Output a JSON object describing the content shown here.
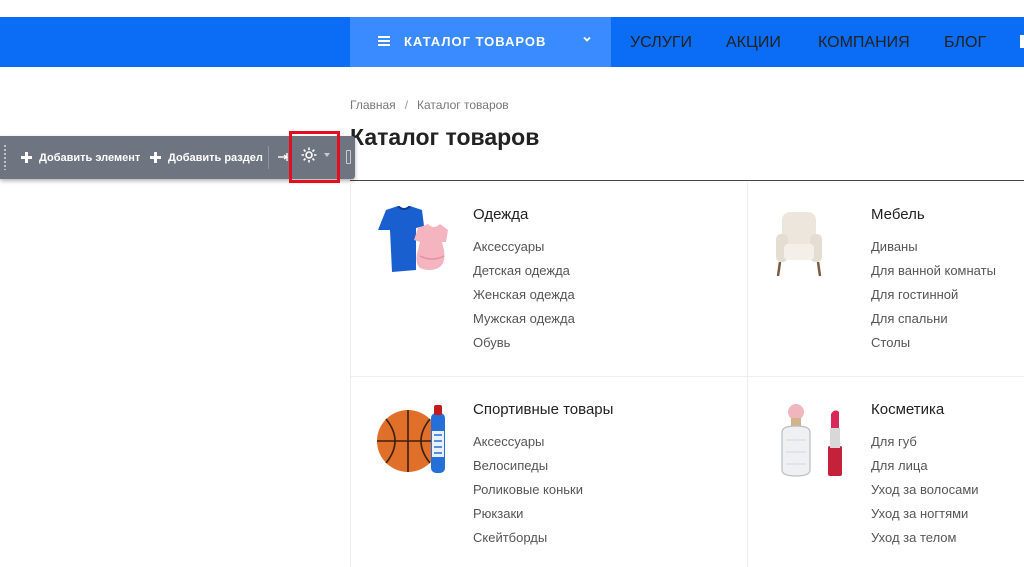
{
  "colors": {
    "nav_bg": "#0b6cf6",
    "catalog_bg": "#3a8bff",
    "toolbar_bg": "#6e7480",
    "highlight": "#e30f1e"
  },
  "header": {
    "catalog_button": {
      "label": "КАТАЛОГ ТОВАРОВ",
      "icon": "menu-icon",
      "chevron": "chevron-down-icon"
    },
    "nav": [
      "УСЛУГИ",
      "АКЦИИ",
      "КОМПАНИЯ",
      "БЛОГ"
    ]
  },
  "breadcrumb": {
    "home": "Главная",
    "separator": "/",
    "current": "Каталог товаров"
  },
  "page_title": "Каталог товаров",
  "admin_toolbar": {
    "add_element": "Добавить элемент",
    "add_section": "Добавить раздел",
    "icons": [
      "drag-handle-icon",
      "pin-icon",
      "gear-icon",
      "caret-down-icon"
    ]
  },
  "categories": [
    {
      "name": "Одежда",
      "image": "clothing-image",
      "items": [
        "Аксессуары",
        "Детская одежда",
        "Женская одежда",
        "Мужская одежда",
        "Обувь"
      ]
    },
    {
      "name": "Мебель",
      "image": "armchair-image",
      "items": [
        "Диваны",
        "Для ванной комнаты",
        "Для гостинной",
        "Для спальни",
        "Столы"
      ]
    },
    {
      "name": "Спортивные товары",
      "image": "basketball-image",
      "items": [
        "Аксессуары",
        "Велосипеды",
        "Роликовые коньки",
        "Рюкзаки",
        "Скейтборды"
      ]
    },
    {
      "name": "Косметика",
      "image": "cosmetics-image",
      "items": [
        "Для губ",
        "Для лица",
        "Уход за волосами",
        "Уход за ногтями",
        "Уход за телом"
      ]
    }
  ]
}
